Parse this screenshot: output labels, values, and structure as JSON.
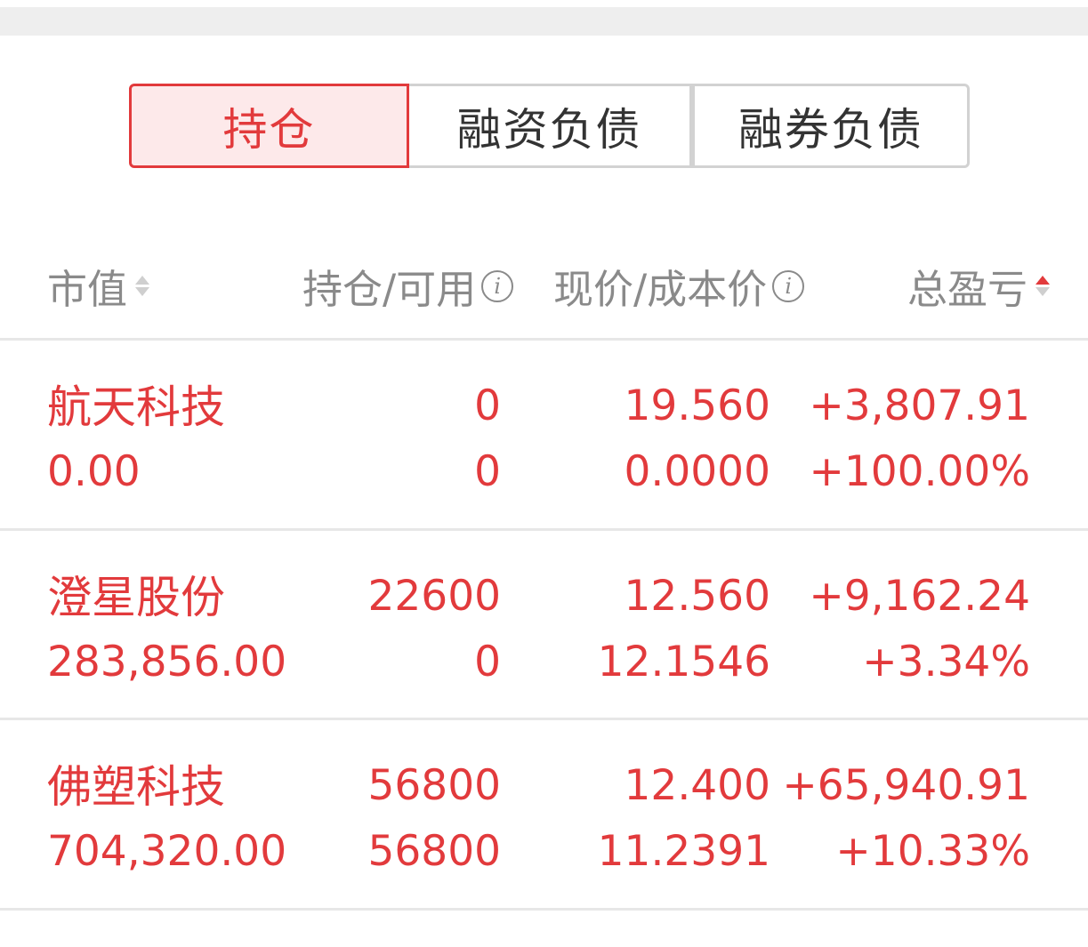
{
  "tabs": [
    {
      "label": "持仓",
      "active": true
    },
    {
      "label": "融资负债",
      "active": false
    },
    {
      "label": "融券负债",
      "active": false
    }
  ],
  "columns": {
    "market_value": "市值",
    "holding_available": "持仓/可用",
    "price_cost": "现价/成本价",
    "total_pl": "总盈亏"
  },
  "rows": [
    {
      "name": "航天科技",
      "market_value": "0.00",
      "holding": "0",
      "available": "0",
      "price": "19.560",
      "cost": "0.0000",
      "total_pl": "+3,807.91",
      "total_pl_pct": "+100.00%"
    },
    {
      "name": "澄星股份",
      "market_value": "283,856.00",
      "holding": "22600",
      "available": "0",
      "price": "12.560",
      "cost": "12.1546",
      "total_pl": "+9,162.24",
      "total_pl_pct": "+3.34%"
    },
    {
      "name": "佛塑科技",
      "market_value": "704,320.00",
      "holding": "56800",
      "available": "56800",
      "price": "12.400",
      "cost": "11.2391",
      "total_pl": "+65,940.91",
      "total_pl_pct": "+10.33%"
    }
  ],
  "colors": {
    "accent": "#e23a3c",
    "active_tab_bg": "#fde9ea",
    "header_text": "#8a8a8a",
    "divider": "#e7e7e7"
  },
  "icons": {
    "info": "info-icon",
    "sort": "sort-icon"
  }
}
